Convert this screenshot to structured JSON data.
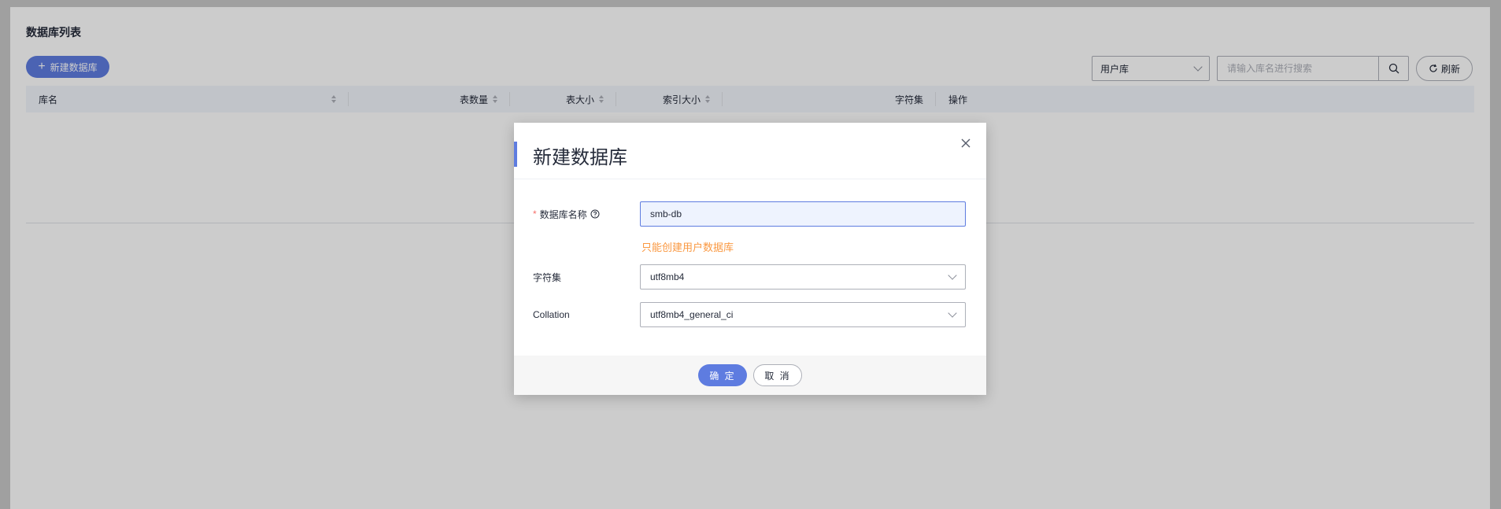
{
  "page": {
    "title": "数据库列表",
    "create_button_label": "新建数据库",
    "filter": {
      "selected": "用户库"
    },
    "search": {
      "placeholder": "请输入库名进行搜索",
      "value": ""
    },
    "refresh_label": "刷新"
  },
  "table": {
    "columns": [
      {
        "label": "库名",
        "sortable": true
      },
      {
        "label": "",
        "sortable": false
      },
      {
        "label": "表数量",
        "sortable": true
      },
      {
        "label": "表大小",
        "sortable": true
      },
      {
        "label": "索引大小",
        "sortable": true
      },
      {
        "label": "字符集",
        "sortable": false
      },
      {
        "label": "操作",
        "sortable": false
      }
    ],
    "rows": []
  },
  "modal": {
    "title": "新建数据库",
    "fields": {
      "name": {
        "required_mark": "*",
        "label": "数据库名称",
        "value": "smb-db"
      },
      "hint": "只能创建用户数据库",
      "charset": {
        "label": "字符集",
        "value": "utf8mb4"
      },
      "collation": {
        "label": "Collation",
        "value": "utf8mb4_general_ci"
      }
    },
    "ok_label": "确 定",
    "cancel_label": "取 消"
  },
  "colors": {
    "primary": "#5e7ce0",
    "warning": "#fa9841",
    "required": "#f66f6a"
  }
}
